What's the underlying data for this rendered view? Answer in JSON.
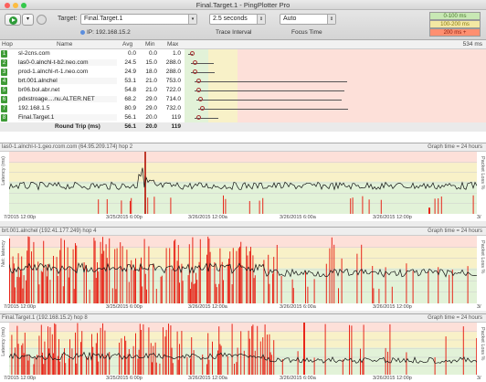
{
  "window": {
    "title": "Final.Target.1 - PingPlotter Pro"
  },
  "toolbar": {
    "target_label": "Target:",
    "target_value": "Final.Target.1",
    "ip_value": "IP: 192.168.15.2",
    "interval_value": "2.5 seconds",
    "interval_caption": "Trace Interval",
    "focus_value": "Auto",
    "focus_caption": "Focus Time",
    "legend": [
      "0-100 ms",
      "100-200 ms",
      "200 ms +"
    ]
  },
  "table": {
    "headers": {
      "hop": "Hop",
      "name": "Name",
      "avg": "Avg",
      "min": "Min",
      "max": "Max",
      "latency": "534 ms"
    },
    "rows": [
      {
        "hop": "1",
        "name": "sl-2cns.com",
        "avg": "0.0",
        "min": "0.0",
        "max": "1.0",
        "pos": 0.01,
        "spread": 0.02
      },
      {
        "hop": "2",
        "name": "las0-0.alnchl-t-b2.neo.com",
        "avg": "24.5",
        "min": "15.0",
        "max": "288.0",
        "pos": 0.06,
        "spread": 0.1
      },
      {
        "hop": "3",
        "name": "prod-1.alnchl-rt-1.neo.com",
        "avg": "24.9",
        "min": "18.0",
        "max": "288.0",
        "pos": 0.07,
        "spread": 0.1
      },
      {
        "hop": "4",
        "name": "brt.001.alnchel",
        "avg": "53.1",
        "min": "21.0",
        "max": "753.0",
        "pos": 0.13,
        "spread": 0.65
      },
      {
        "hop": "5",
        "name": "br06.bol.abr.net",
        "avg": "54.8",
        "min": "21.0",
        "max": "722.0",
        "pos": 0.13,
        "spread": 0.64
      },
      {
        "hop": "6",
        "name": "pdxstroage....nu.ALTER.NET",
        "avg": "68.2",
        "min": "29.0",
        "max": "714.0",
        "pos": 0.16,
        "spread": 0.62
      },
      {
        "hop": "7",
        "name": "192.168.1.5",
        "avg": "80.9",
        "min": "29.0",
        "max": "732.0",
        "pos": 0.19,
        "spread": 0.64
      },
      {
        "hop": "8",
        "name": "Final.Target.1",
        "avg": "56.1",
        "min": "20.0",
        "max": "119",
        "pos": 0.13,
        "spread": 0.1
      }
    ],
    "round_trip": {
      "label": "Round Trip (ms)",
      "avg": "56.1",
      "min": "20.0",
      "max": "119"
    }
  },
  "graphs": [
    {
      "title": "las0-1.alnchl-t-1.geo.rcom.com (64.95.209.174) hop 2",
      "time_range": "Graph time = 24 hours",
      "left_label": "Latency (ms)",
      "right_label": "Packet Loss %",
      "x_ticks": [
        "7/2015 12:00p",
        "3/25/2015 6:00p",
        "3/26/2015 12:00a",
        "3/26/2015 6:00a",
        "3/26/2015 12:00p",
        "3/"
      ]
    },
    {
      "title": "brt.001.alnchel (192.41.177.249) hop 4",
      "time_range": "Graph time = 24 hours",
      "left_label": "Net: latency",
      "right_label": "Packet Loss %",
      "x_ticks": [
        "7/2015 12:00p",
        "3/25/2015 6:00p",
        "3/26/2015 12:00a",
        "3/26/2015 6:00a",
        "3/26/2015 12:00p",
        "3/"
      ]
    },
    {
      "title": "Final.Target.1 (192.168.15.2) hop 8",
      "time_range": "Graph time = 24 hours",
      "left_label": "Latency (ms)",
      "right_label": "Packet Loss %",
      "x_ticks": [
        "7/2015 12:00p",
        "3/25/2015 6:00p",
        "3/26/2015 12:00a",
        "3/26/2015 6:00a",
        "3/26/2015 12:00p",
        "3/"
      ]
    }
  ],
  "colors": {
    "green": "#c8e8b4",
    "yellow": "#f4e8a3",
    "red": "#ff9f8a",
    "loss": "#e8261a",
    "accent": "#3e9b36"
  }
}
